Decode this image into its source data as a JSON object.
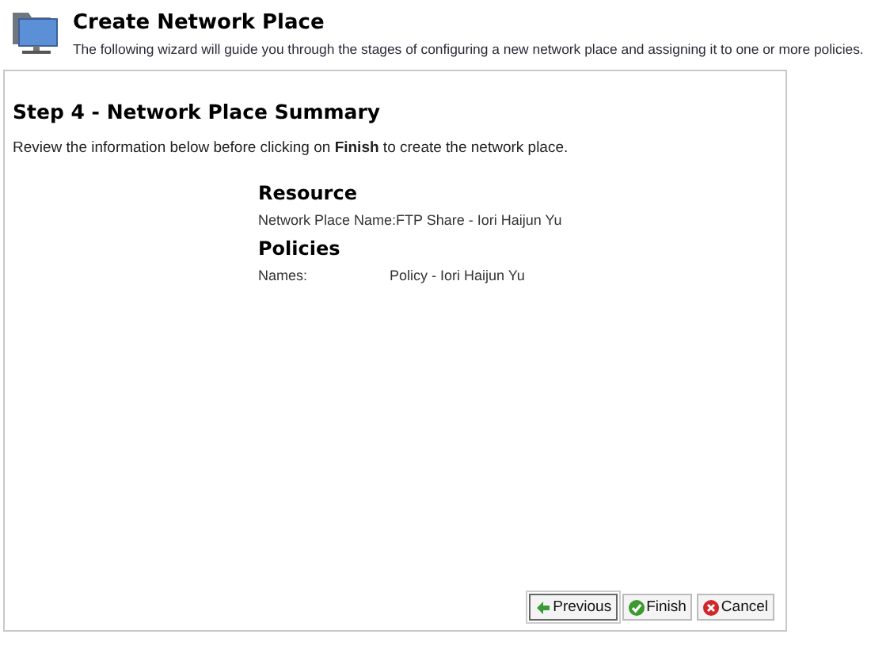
{
  "header": {
    "title": "Create Network Place",
    "description": "The following wizard will guide you through the stages of configuring a new network place and assigning it to one or more policies."
  },
  "step": {
    "title": "Step 4 - Network Place Summary",
    "intro": "Review the information below before clicking on **Finish** to create the network place."
  },
  "sections": [
    {
      "title": "Resource",
      "rows": [
        {
          "label": "Network Place Name:",
          "value": "FTP Share - Iori Haijun Yu"
        }
      ]
    },
    {
      "title": "Policies",
      "rows": [
        {
          "label": "Names:",
          "value": "Policy - Iori Haijun Yu"
        }
      ]
    }
  ],
  "buttons": [
    {
      "label": "Previous",
      "kind": "previous"
    },
    {
      "label": "Finish",
      "kind": "finish"
    },
    {
      "label": "Cancel",
      "kind": "cancel"
    }
  ]
}
